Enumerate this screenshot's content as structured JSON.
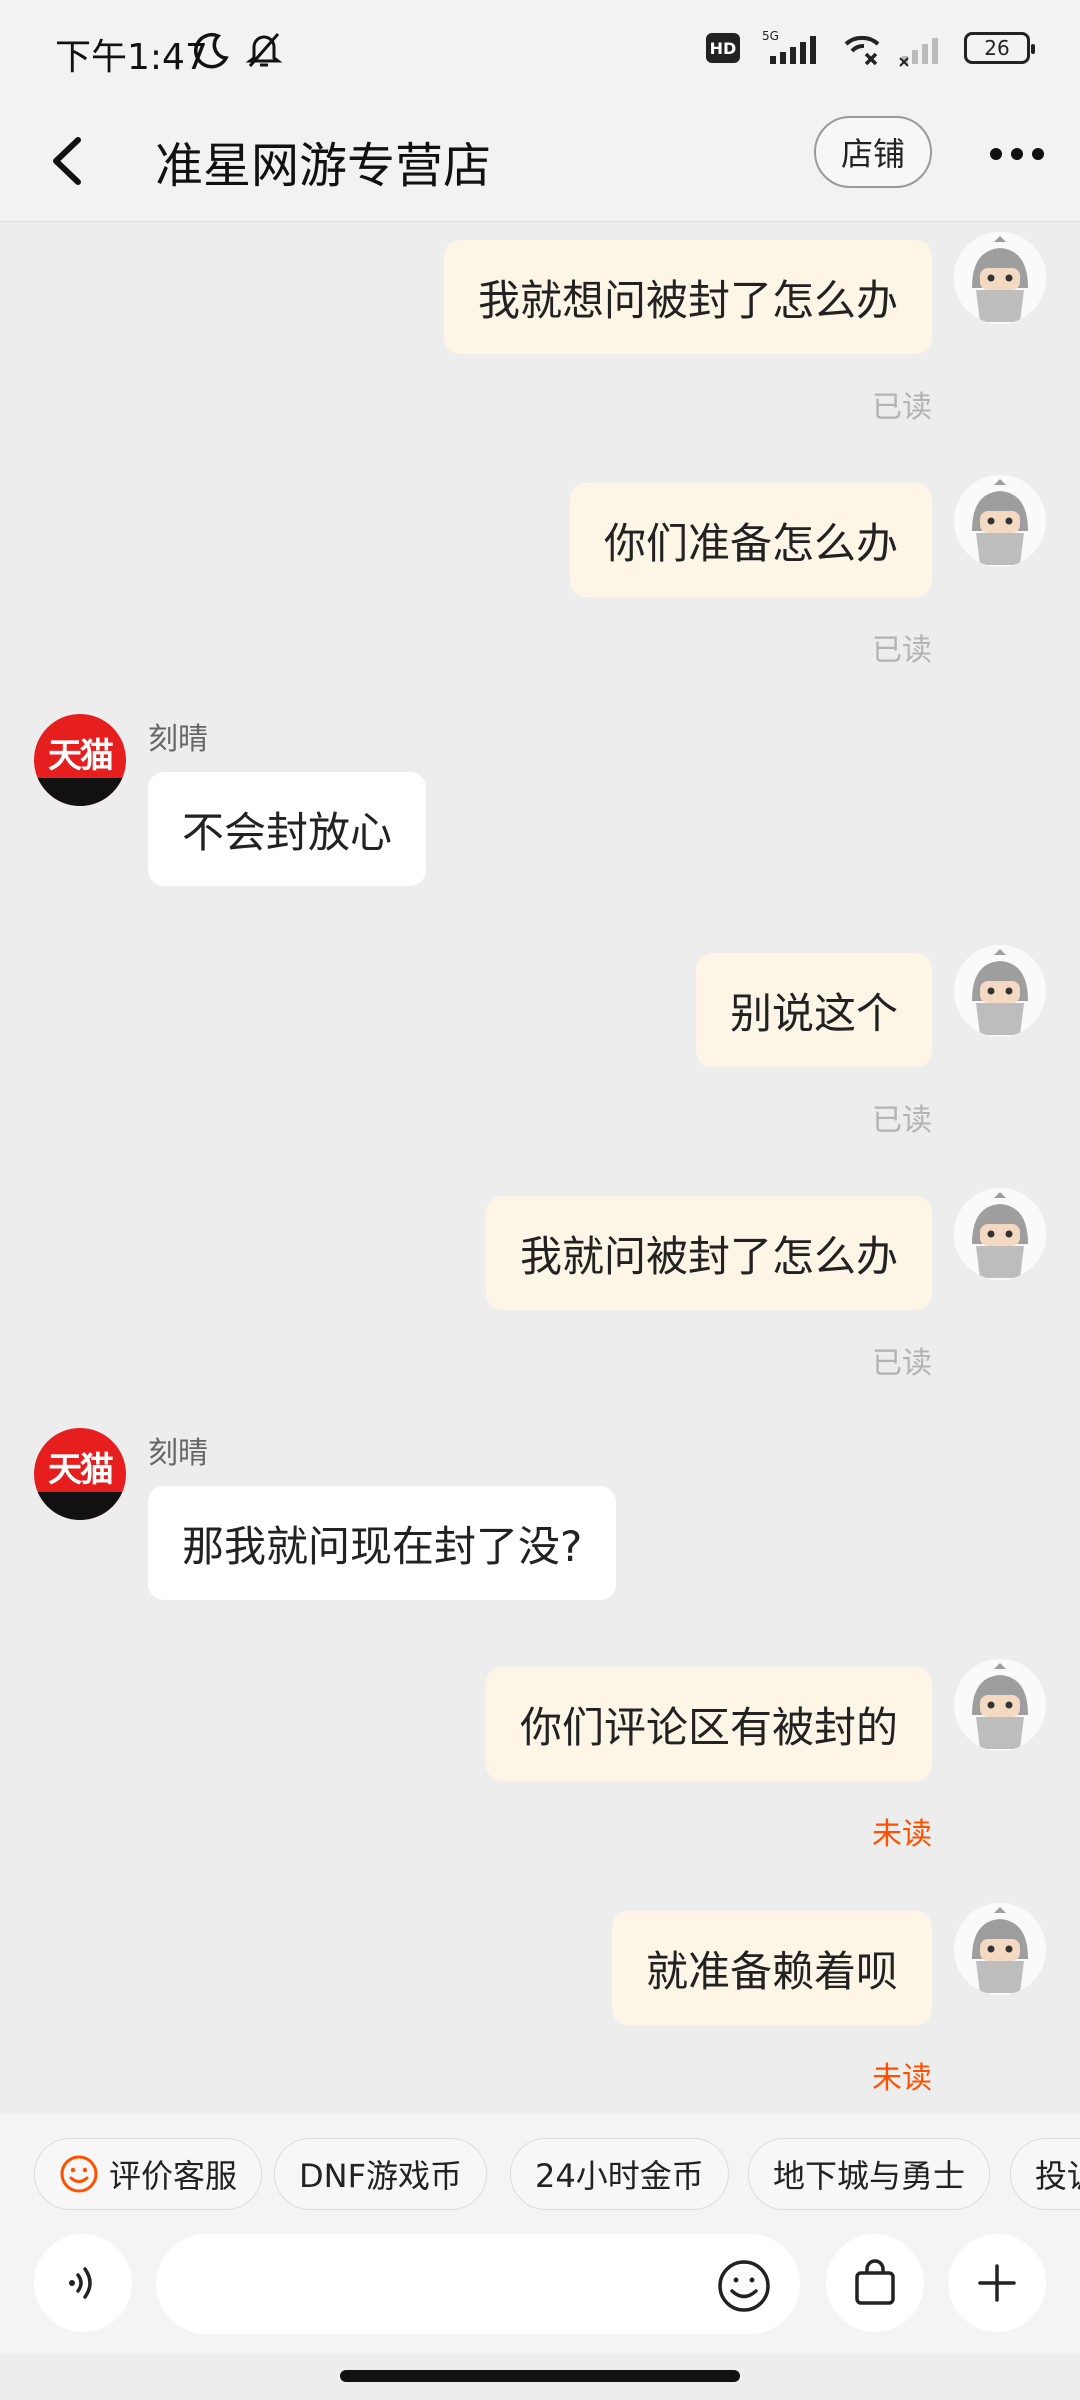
{
  "status_bar": {
    "time": "下午1:47",
    "battery": "26",
    "network": "5G"
  },
  "header": {
    "title": "准星网游专营店",
    "shop_button": "店铺"
  },
  "messages": [
    {
      "side": "mine",
      "text": "我就想问被封了怎么办",
      "status": "已读"
    },
    {
      "side": "mine",
      "text": "你们准备怎么办",
      "status": "已读"
    },
    {
      "side": "theirs",
      "sender": "刻晴",
      "text": "不会封放心"
    },
    {
      "side": "mine",
      "text": "别说这个",
      "status": "已读"
    },
    {
      "side": "mine",
      "text": "我就问被封了怎么办",
      "status": "已读"
    },
    {
      "side": "theirs",
      "sender": "刻晴",
      "text": "那我就问现在封了没?"
    },
    {
      "side": "mine",
      "text": "你们评论区有被封的",
      "status": "未读"
    },
    {
      "side": "mine",
      "text": "就准备赖着呗",
      "status": "未读"
    }
  ],
  "shop_avatar_text": "天猫",
  "quick_replies": [
    "评价客服",
    "DNF游戏币",
    "24小时金币",
    "地下城与勇士",
    "投诉"
  ],
  "input": {
    "placeholder": ""
  },
  "colors": {
    "unread": "#ff5000",
    "my_bubble": "#fdf5e6",
    "accent": "#ff5000"
  }
}
